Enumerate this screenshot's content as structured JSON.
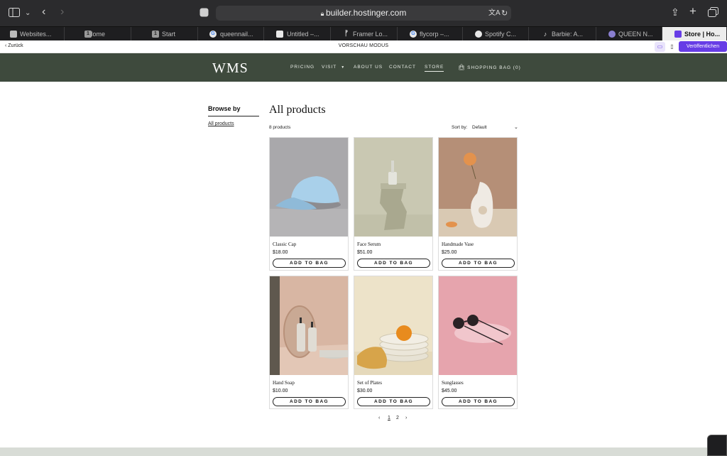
{
  "browser": {
    "url": "builder.hostinger.com",
    "tabs": [
      {
        "label": "Websites...",
        "icon": "hostinger-icon"
      },
      {
        "label": "Home",
        "icon": "number-1-icon"
      },
      {
        "label": "Start",
        "icon": "number-1-icon"
      },
      {
        "label": "queennail...",
        "icon": "google-icon"
      },
      {
        "label": "Untitled –...",
        "icon": "app-icon"
      },
      {
        "label": "Framer Lo...",
        "icon": "framer-icon"
      },
      {
        "label": "flycorp –...",
        "icon": "google-icon"
      },
      {
        "label": "Spotify C...",
        "icon": "spotify-icon"
      },
      {
        "label": "Barbie: A...",
        "icon": "tiktok-icon"
      },
      {
        "label": "QUEEN N...",
        "icon": "app-icon"
      },
      {
        "label": "Store | Ho...",
        "icon": "hostinger-icon",
        "active": true
      }
    ]
  },
  "preview": {
    "back_label": "Zurück",
    "mode_label": "VORSCHAU MODUS",
    "publish_label": "Veröffentlichen"
  },
  "site": {
    "logo": "WMS",
    "nav": {
      "pricing": "PRICING",
      "visit": "VISIT",
      "about": "ABOUT US",
      "contact": "CONTACT",
      "store": "STORE",
      "bag": "SHOPPING BAG (0)"
    }
  },
  "sidebar": {
    "title": "Browse by",
    "link": "All products"
  },
  "main": {
    "title": "All products",
    "count": "8 products",
    "sort_label": "Sort by:",
    "sort_value": "Default",
    "add_label": "ADD TO BAG",
    "products": [
      {
        "name": "Classic Cap",
        "price": "$18.00"
      },
      {
        "name": "Face Serum",
        "price": "$51.00"
      },
      {
        "name": "Handmade Vase",
        "price": "$25.00"
      },
      {
        "name": "Hand Soap",
        "price": "$10.00"
      },
      {
        "name": "Set of Plates",
        "price": "$30.00"
      },
      {
        "name": "Sunglasses",
        "price": "$45.00"
      }
    ],
    "pages": [
      "1",
      "2"
    ]
  },
  "colors": {
    "header_bg": "#3e4a3d",
    "publish": "#673de6"
  }
}
